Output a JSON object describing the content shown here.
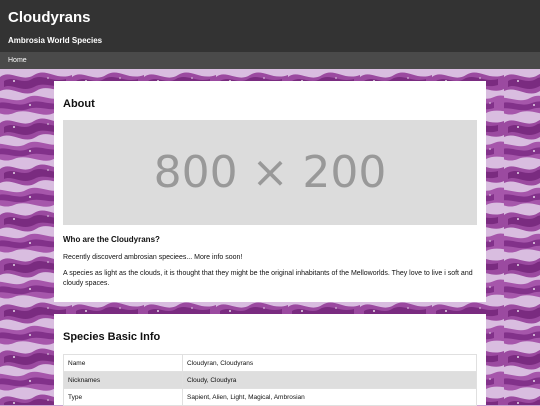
{
  "header": {
    "title": "Cloudyrans",
    "subtitle": "Ambrosia World Species"
  },
  "nav": {
    "items": [
      "Home"
    ]
  },
  "colors": {
    "header_bg": "#333333",
    "nav_bg": "#4a4a4a",
    "pattern_light": "#d6b7dc",
    "pattern_dark": "#8e3c93"
  },
  "about": {
    "heading": "About",
    "image_placeholder": "800 × 200",
    "subheading": "Who are the Cloudyrans?",
    "paragraph1": "Recently discoverd ambrosian speciees... More info soon!",
    "paragraph2": "A species as light as the clouds, it is thought that they might be the original inhabitants of the Melloworlds. They love to live i soft and cloudy spaces."
  },
  "species_info": {
    "heading": "Species Basic Info",
    "rows": [
      {
        "key": "Name",
        "value": "Cloudyran, Cloudyrans"
      },
      {
        "key": "Nicknames",
        "value": "Cloudy, Cloudyra"
      },
      {
        "key": "Type",
        "value": "Sapient, Alien, Light, Magical, Ambrosian"
      }
    ]
  }
}
